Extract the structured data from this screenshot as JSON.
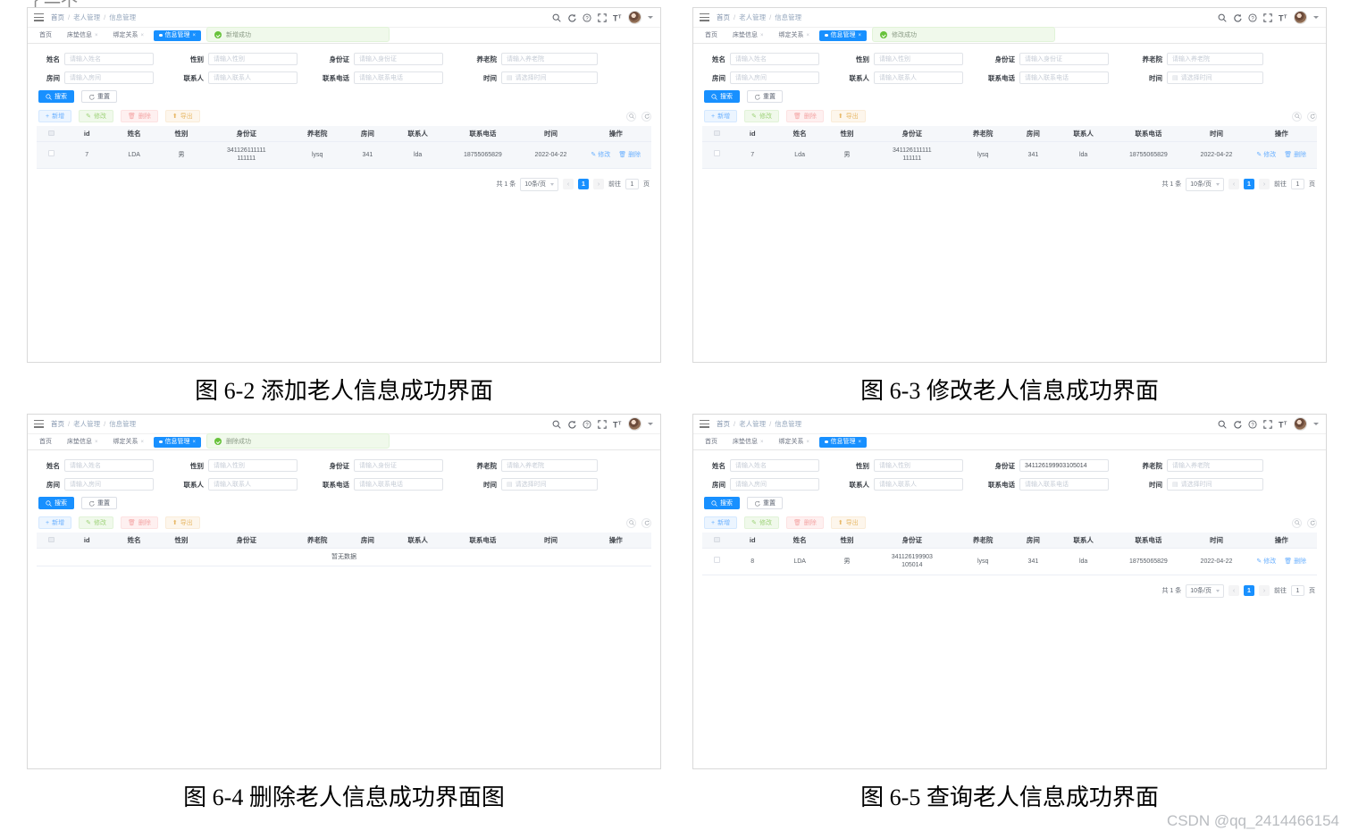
{
  "document": {
    "top_cutoff_text": "了一个  ,   ,    ,    ,     ,    ,    ,   ,   ,",
    "watermark": "CSDN @qq_2414466154",
    "captions": [
      "图 6-2  添加老人信息成功界面",
      "图 6-3  修改老人信息成功界面",
      "图 6-4  删除老人信息成功界面图",
      "图 6-5  查询老人信息成功界面"
    ]
  },
  "app": {
    "breadcrumb": [
      "首页",
      "老人管理",
      "信息管理"
    ],
    "breadcrumb_sep": "/",
    "topbar_icons": [
      "search-icon",
      "refresh-icon",
      "help-icon",
      "fullscreen-icon",
      "font-size-icon"
    ],
    "tabs": [
      {
        "label": "首页",
        "closable": false,
        "active": false
      },
      {
        "label": "床垫信息",
        "closable": true,
        "active": false
      },
      {
        "label": "绑定关系",
        "closable": true,
        "active": false
      },
      {
        "label": "信息管理",
        "closable": true,
        "active": true
      }
    ],
    "tab_close_glyph": "×",
    "form": {
      "labels": {
        "name": "姓名",
        "gender": "性别",
        "idcard": "身份证",
        "nursing_home": "养老院",
        "room": "房间",
        "contact": "联系人",
        "phone": "联系电话",
        "time": "时间"
      },
      "placeholders": {
        "name": "请输入姓名",
        "gender": "请输入性别",
        "idcard": "请输入身份证",
        "nursing_home": "请输入养老院",
        "room": "请输入房间",
        "contact": "请输入联系人",
        "phone": "请输入联系电话",
        "time": "请选择时间"
      }
    },
    "buttons": {
      "search": "搜索",
      "reset": "重置",
      "add": "新增",
      "edit": "修改",
      "delete": "删除",
      "export": "导出"
    },
    "table": {
      "headers": [
        "id",
        "姓名",
        "性别",
        "身份证",
        "养老院",
        "房间",
        "联系人",
        "联系电话",
        "时间",
        "操作"
      ],
      "row_actions": {
        "edit": "修改",
        "delete": "删除"
      },
      "empty_text": "暂无数据"
    },
    "pagination": {
      "total": "共 1 条",
      "page_size": "10条/页",
      "prev": "‹",
      "next": "›",
      "current": "1",
      "goto_label": "前往",
      "goto_value": "1",
      "goto_unit": "页"
    },
    "colors": {
      "primary": "#1890ff",
      "success_bg": "#f0f9eb",
      "success_fg": "#67c23a",
      "header_bg": "#f5f7fa"
    }
  },
  "panels": [
    {
      "id": "panel-add",
      "toast": "新增成功",
      "idcard_value": "",
      "rows": [
        {
          "id": "7",
          "name": "LDA",
          "gender": "男",
          "idcard": "341126111111111111",
          "nursing_home": "lysq",
          "room": "341",
          "contact": "lda",
          "phone": "18755065829",
          "time": "2022-04-22"
        }
      ],
      "has_pagination": true,
      "row_highlighted": true
    },
    {
      "id": "panel-edit",
      "toast": "修改成功",
      "idcard_value": "",
      "rows": [
        {
          "id": "7",
          "name": "Lda",
          "gender": "男",
          "idcard": "341126111111111111",
          "nursing_home": "lysq",
          "room": "341",
          "contact": "lda",
          "phone": "18755065829",
          "time": "2022-04-22"
        }
      ],
      "has_pagination": true,
      "row_highlighted": true
    },
    {
      "id": "panel-delete",
      "toast": "删除成功",
      "idcard_value": "",
      "rows": [],
      "has_pagination": false,
      "row_highlighted": false
    },
    {
      "id": "panel-query",
      "toast": "",
      "idcard_value": "341126199903105014",
      "rows": [
        {
          "id": "8",
          "name": "LDA",
          "gender": "男",
          "idcard": "341126199903105014",
          "nursing_home": "lysq",
          "room": "341",
          "contact": "lda",
          "phone": "18755065829",
          "time": "2022-04-22"
        }
      ],
      "has_pagination": true,
      "row_highlighted": false
    }
  ]
}
